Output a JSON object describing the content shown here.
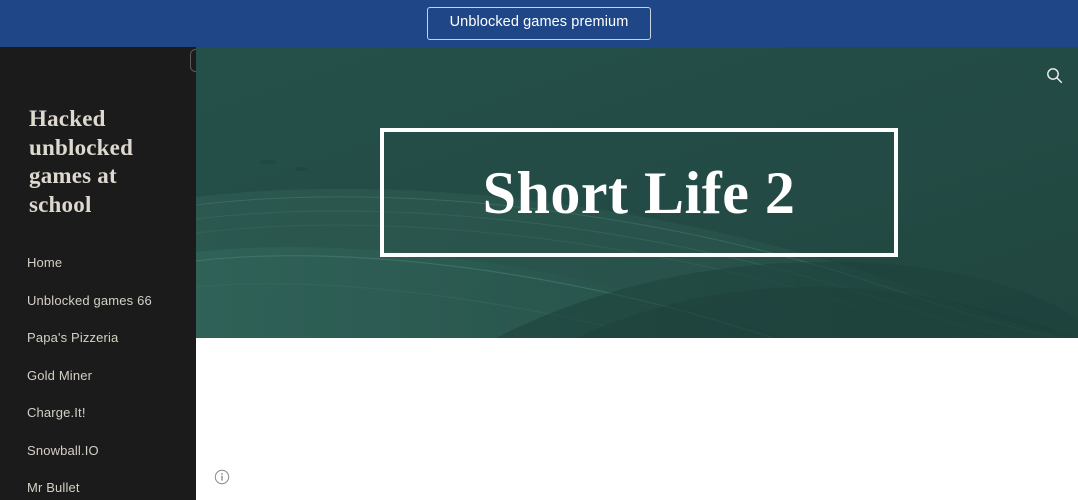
{
  "banner": {
    "button_label": "Unblocked games premium",
    "background_color": "#1f4788",
    "text_color": "#ffffff"
  },
  "sidebar": {
    "background_color": "#1b1b1b",
    "title": "Hacked unblocked games at school",
    "title_color": "#ded9ce",
    "handle_name": "sidebar-resize-handle",
    "items": [
      {
        "label": "Home"
      },
      {
        "label": "Unblocked games 66"
      },
      {
        "label": "Papa's Pizzeria"
      },
      {
        "label": "Gold Miner"
      },
      {
        "label": "Charge.It!"
      },
      {
        "label": "Snowball.IO"
      },
      {
        "label": "Mr Bullet"
      }
    ]
  },
  "hero": {
    "title": "Short Life 2",
    "background_color": "#234a44",
    "border_color": "#ffffff",
    "search_icon": "search-icon"
  },
  "content": {
    "info_icon": "info-circle-icon"
  }
}
